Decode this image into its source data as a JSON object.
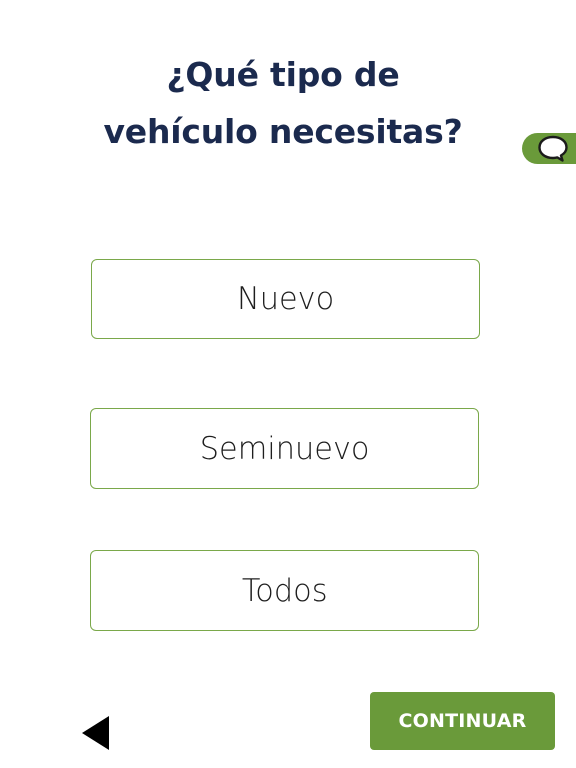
{
  "question": {
    "line1": "¿Qué tipo de",
    "line2": "vehículo necesitas?"
  },
  "options": [
    {
      "label": "Nuevo"
    },
    {
      "label": "Seminuevo"
    },
    {
      "label": "Todos"
    }
  ],
  "footer": {
    "continue_label": "CONTINUAR",
    "back_icon": "back-triangle-icon"
  },
  "chat": {
    "icon": "chat-bubble-icon"
  },
  "colors": {
    "title": "#1b2a4e",
    "accent_green": "#6a9a3a",
    "option_border": "#7aa84a",
    "option_text": "#1e1e1e",
    "background": "#ffffff"
  }
}
